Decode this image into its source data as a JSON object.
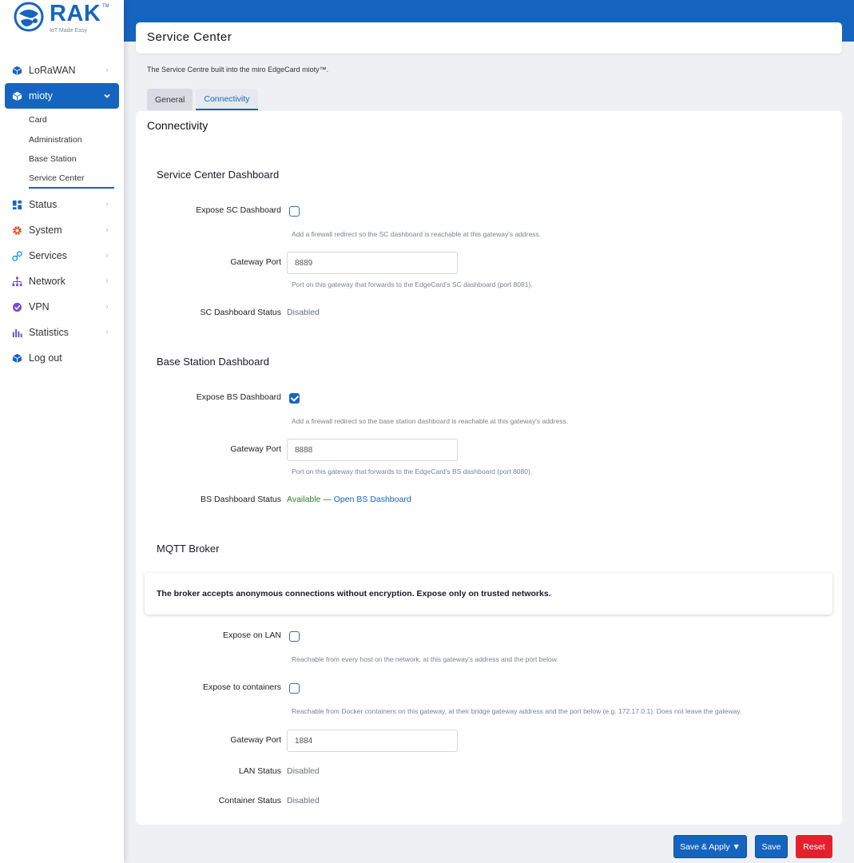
{
  "brand": {
    "name": "RAK",
    "tm": "TM",
    "tagline": "IoT Made Easy"
  },
  "nav": {
    "items": [
      {
        "label": "LoRaWAN",
        "icon": "cube-icon",
        "color": "#1565c0"
      },
      {
        "label": "mioty",
        "icon": "cube-icon",
        "color": "#1565c0",
        "active": true,
        "sub": [
          "Card",
          "Administration",
          "Base Station",
          "Service Center"
        ]
      },
      {
        "label": "Status",
        "icon": "dashboard-icon",
        "color": "#1565c0"
      },
      {
        "label": "System",
        "icon": "gear-icon",
        "color": "#e8491d"
      },
      {
        "label": "Services",
        "icon": "services-icon",
        "color": "#1e9bd7"
      },
      {
        "label": "Network",
        "icon": "network-icon",
        "color": "#6a4cc4"
      },
      {
        "label": "VPN",
        "icon": "shield-icon",
        "color": "#7b4fc9"
      },
      {
        "label": "Statistics",
        "icon": "bar-chart-icon",
        "color": "#6a4cc4"
      },
      {
        "label": "Log out",
        "icon": "cube-icon",
        "color": "#1565c0"
      }
    ]
  },
  "page": {
    "title": "Service Center",
    "description": "The Service Centre built into the miro EdgeCard mioty™.",
    "tabs": [
      "General",
      "Connectivity"
    ],
    "panel_title": "Connectivity"
  },
  "sc": {
    "title": "Service Center Dashboard",
    "expose_label": "Expose SC Dashboard",
    "expose_checked": false,
    "expose_hint": "Add a firewall redirect so the SC dashboard is reachable at this gateway's address.",
    "port_label": "Gateway Port",
    "port_value": "8889",
    "port_hint": "Port on this gateway that forwards to the EdgeCard's SC dashboard (port 8081).",
    "status_label": "SC Dashboard Status",
    "status_value": "Disabled"
  },
  "bs": {
    "title": "Base Station Dashboard",
    "expose_label": "Expose BS Dashboard",
    "expose_checked": true,
    "expose_hint": "Add a firewall redirect so the base station dashboard is reachable at this gateway's address.",
    "port_label": "Gateway Port",
    "port_value": "8888",
    "port_hint": "Port on this gateway that forwards to the EdgeCard's BS dashboard (port 8080).",
    "status_label": "BS Dashboard Status",
    "status_value": "Available",
    "status_sep": "—",
    "status_link": "Open BS Dashboard"
  },
  "mqtt": {
    "title": "MQTT Broker",
    "warning": "The broker accepts anonymous connections without encryption. Expose only on trusted networks.",
    "lan_label": "Expose on LAN",
    "lan_checked": false,
    "lan_hint": "Reachable from every host on the network, at this gateway's address and the port below.",
    "containers_label": "Expose to containers",
    "containers_checked": false,
    "containers_hint": "Reachable from Docker containers on this gateway, at their bridge gateway address and the port below (e.g. 172.17.0.1). Does not leave the gateway.",
    "port_label": "Gateway Port",
    "port_value": "1884",
    "lan_status_label": "LAN Status",
    "lan_status_value": "Disabled",
    "container_status_label": "Container Status",
    "container_status_value": "Disabled"
  },
  "actions": {
    "save_apply": "Save & Apply ▼",
    "save": "Save",
    "reset": "Reset"
  }
}
